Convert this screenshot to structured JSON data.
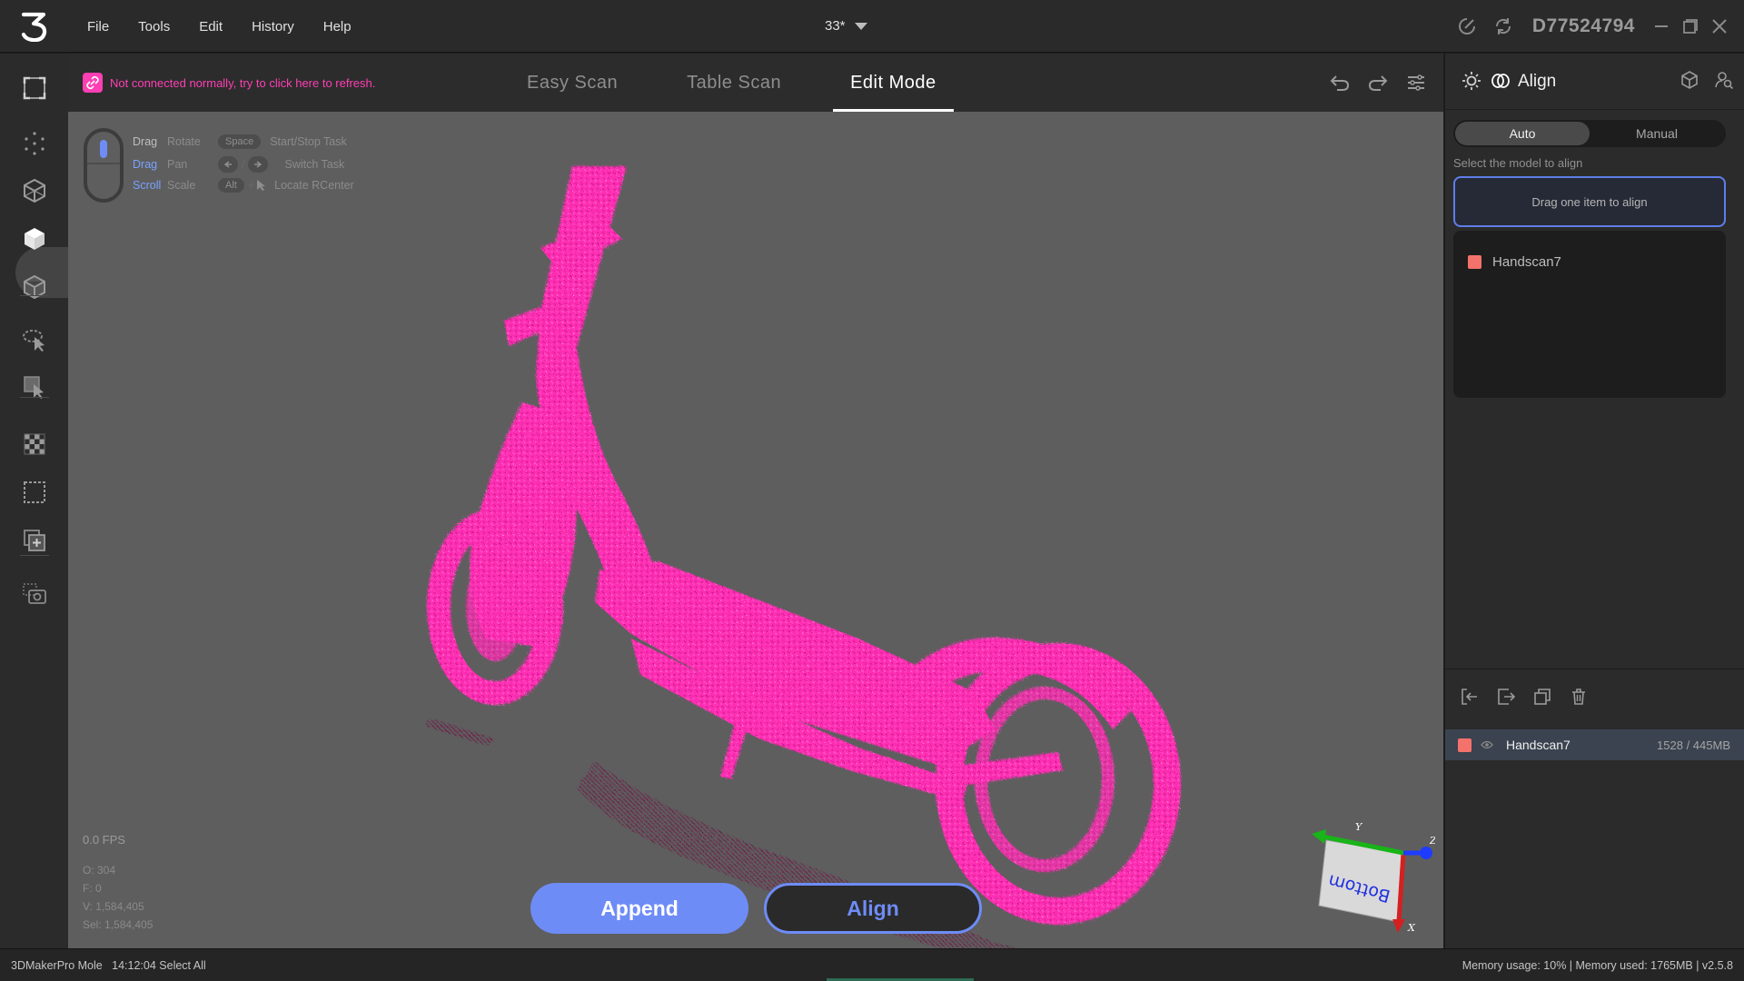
{
  "app": {
    "logo_text": "3",
    "menu": [
      {
        "label": "File"
      },
      {
        "label": "Tools"
      },
      {
        "label": "Edit"
      },
      {
        "label": "History"
      },
      {
        "label": "Help"
      }
    ],
    "project_name": "33*",
    "device_id": "D77524794"
  },
  "warning": {
    "text": "Not connected normally, try to click here to refresh."
  },
  "tabs": [
    {
      "label": "Easy Scan",
      "active": false
    },
    {
      "label": "Table Scan",
      "active": false
    },
    {
      "label": "Edit Mode",
      "active": true
    }
  ],
  "hints": {
    "rows": [
      {
        "key": "Drag",
        "action": "Rotate",
        "shortcut": "Space",
        "desc": "Start/Stop Task"
      },
      {
        "key": "Drag",
        "action": "Pan",
        "shortcut": "",
        "desc": "Switch Task"
      },
      {
        "key": "Scroll",
        "action": "Scale",
        "shortcut": "Alt",
        "desc": "Locate RCenter"
      }
    ]
  },
  "stats": {
    "fps": "0.0 FPS",
    "o": "O: 304",
    "f": "F: 0",
    "v": "V: 1,584,405",
    "sel": "Sel: 1,584,405"
  },
  "buttons": {
    "append": "Append",
    "align": "Align"
  },
  "axis": {
    "x_label": "X",
    "y_label": "Y",
    "z_label": "Z",
    "face_label": "Bottom",
    "colors": {
      "x": "#d42020",
      "y": "#18b418",
      "z": "#1e3cff"
    }
  },
  "panel": {
    "title": "Align",
    "mode_tabs": [
      {
        "label": "Auto",
        "active": true
      },
      {
        "label": "Manual",
        "active": false
      }
    ],
    "select_label": "Select the model to align",
    "dropzone_text": "Drag one item to align",
    "models": [
      {
        "name": "Handscan7",
        "color": "#f4726c"
      }
    ],
    "scan_row": {
      "name": "Handscan7",
      "size": "1528 / 445MB",
      "color": "#f4726c"
    }
  },
  "statusbar": {
    "left": "3DMakerPro Mole   14:12:04 Select All",
    "right": "Memory usage: 10% | Memory used: 1765MB | v2.5.8"
  },
  "colors": {
    "accent": "#6e8cf6",
    "warning": "#ff3fb4",
    "pointcloud": "#ff2db4"
  }
}
